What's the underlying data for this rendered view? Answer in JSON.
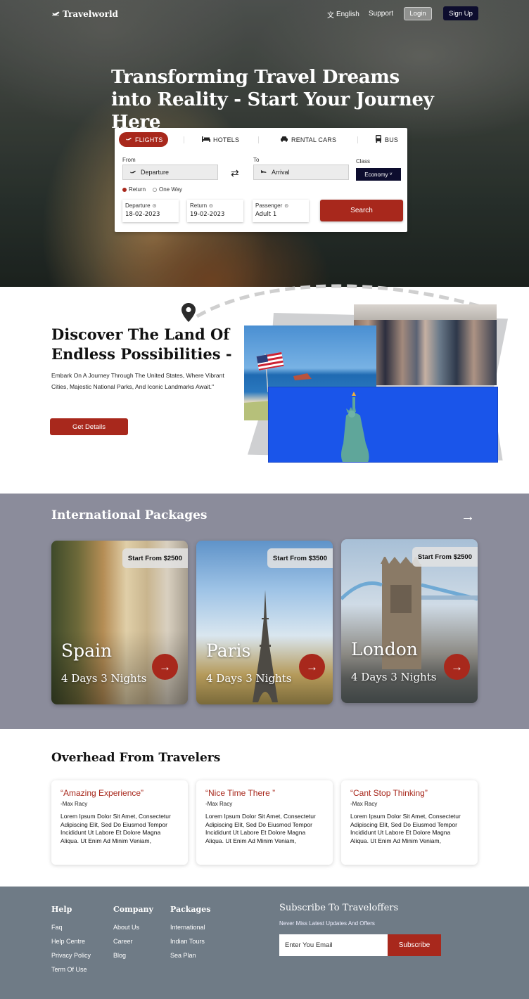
{
  "nav": {
    "logo": "Travelworld",
    "language": "English",
    "support": "Support",
    "login": "Login",
    "signup": "Sign Up"
  },
  "hero": {
    "title": "Transforming Travel Dreams into Reality - Start Your Journey Here"
  },
  "search": {
    "tabs": [
      {
        "label": "FLIGHTS",
        "icon": "plane-icon",
        "active": true
      },
      {
        "label": "HOTELS",
        "icon": "bed-icon",
        "active": false
      },
      {
        "label": "RENTAL CARS",
        "icon": "car-icon",
        "active": false
      },
      {
        "label": "BUS",
        "icon": "bus-icon",
        "active": false
      }
    ],
    "from_label": "From",
    "from_value": "Departure",
    "to_label": "To",
    "to_value": "Arrival",
    "class_label": "Class",
    "class_value": "Economy",
    "trip_types": [
      "Return",
      "One Way"
    ],
    "trip_selected": "Return",
    "departure_label": "Departure",
    "departure_date": "18-02-2023",
    "return_label": "Return",
    "return_date": "19-02-2023",
    "passenger_label": "Passenger",
    "passenger_value": "Adult 1",
    "search_button": "Search"
  },
  "discover": {
    "title": "Discover The Land Of Endless Possibilities -",
    "body": "Embark On A Journey Through The United States, Where Vibrant Cities, Majestic National Parks, And Iconic Landmarks Await.\"",
    "button": "Get Details"
  },
  "packages": {
    "title": "International Packages",
    "items": [
      {
        "city": "Spain",
        "duration": "4 Days 3 Nights",
        "price": "Start From $2500"
      },
      {
        "city": "Paris",
        "duration": "4 Days 3 Nights",
        "price": "Start From $3500"
      },
      {
        "city": "London",
        "duration": "4 Days 3 Nights",
        "price": "Start From $2500"
      }
    ]
  },
  "travelers": {
    "title": "Overhead From Travelers",
    "items": [
      {
        "quote": "“Amazing Experience”",
        "author": "-Max Racy",
        "body": "Lorem Ipsum Dolor Sit Amet, Consectetur Adipiscing Elit, Sed Do Eiusmod Tempor Incididunt Ut Labore Et Dolore Magna Aliqua. Ut Enim Ad Minim Veniam,"
      },
      {
        "quote": "“Nice Time There ”",
        "author": "-Max Racy",
        "body": "Lorem Ipsum Dolor Sit Amet, Consectetur Adipiscing Elit, Sed Do Eiusmod Tempor Incididunt Ut Labore Et Dolore Magna Aliqua. Ut Enim Ad Minim Veniam,"
      },
      {
        "quote": "“Cant Stop Thinking”",
        "author": "-Max Racy",
        "body": "Lorem Ipsum Dolor Sit Amet, Consectetur Adipiscing Elit, Sed Do Eiusmod Tempor Incididunt Ut Labore Et Dolore Magna Aliqua. Ut Enim Ad Minim Veniam,"
      }
    ]
  },
  "footer": {
    "columns": [
      {
        "heading": "Help",
        "links": [
          "Faq",
          "Help Centre",
          "Privacy Policy",
          "Term Of Use"
        ]
      },
      {
        "heading": "Company",
        "links": [
          "About Us",
          "Career",
          "Blog"
        ]
      },
      {
        "heading": "Packages",
        "links": [
          "International",
          "Indian Tours",
          "Sea Plan"
        ]
      }
    ],
    "subscribe_title": "Subscribe To Traveloffers",
    "subscribe_subtitle": "Never Miss Latest Updates And Offers",
    "email_placeholder": "Enter You Email",
    "subscribe_button": "Subscribe"
  },
  "colors": {
    "accent": "#a8281c",
    "navy": "#0d0d2e",
    "packages_bg": "#8b8c9b",
    "footer_bg": "#6f7b86"
  }
}
